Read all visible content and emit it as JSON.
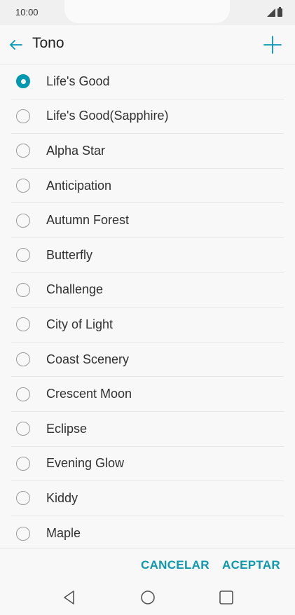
{
  "status_bar": {
    "time": "10:00",
    "signal_icon": "signal-icon",
    "battery_icon": "battery-icon"
  },
  "app_bar": {
    "title": "Tono",
    "back_icon": "back-arrow-icon",
    "add_icon": "plus-icon"
  },
  "ringtones": [
    {
      "label": "Life's Good",
      "selected": true
    },
    {
      "label": "Life's Good(Sapphire)",
      "selected": false
    },
    {
      "label": "Alpha Star",
      "selected": false
    },
    {
      "label": "Anticipation",
      "selected": false
    },
    {
      "label": "Autumn Forest",
      "selected": false
    },
    {
      "label": "Butterfly",
      "selected": false
    },
    {
      "label": "Challenge",
      "selected": false
    },
    {
      "label": "City of Light",
      "selected": false
    },
    {
      "label": "Coast Scenery",
      "selected": false
    },
    {
      "label": "Crescent Moon",
      "selected": false
    },
    {
      "label": "Eclipse",
      "selected": false
    },
    {
      "label": "Evening Glow",
      "selected": false
    },
    {
      "label": "Kiddy",
      "selected": false
    },
    {
      "label": "Maple",
      "selected": false
    }
  ],
  "actions": {
    "cancel_label": "CANCELAR",
    "accept_label": "ACEPTAR"
  },
  "colors": {
    "accent": "#0098b0",
    "text": "#303030",
    "divider": "#e6e6e6"
  },
  "nav_bar": {
    "back_icon": "nav-back-icon",
    "home_icon": "nav-home-icon",
    "recents_icon": "nav-recents-icon"
  }
}
